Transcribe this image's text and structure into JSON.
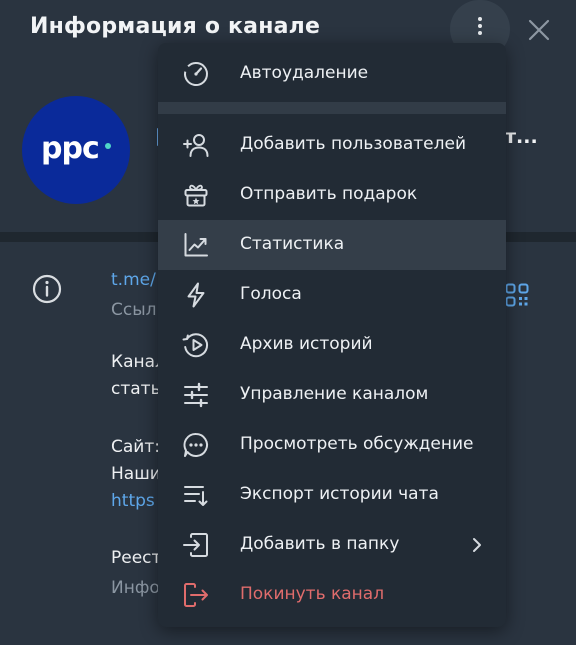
{
  "header": {
    "title": "Информация о канале"
  },
  "channel": {
    "avatar_text": "ppc",
    "name_tail": "т...",
    "colors": {
      "avatar_bg": "#0a2a9a",
      "accent": "#4fd6c8"
    }
  },
  "info": {
    "link_text": "t.me/",
    "link_caption": "Ссыл",
    "desc_line1": "Канал",
    "desc_line2": "стать",
    "site_line1": "Сайт:",
    "site_line2": "Наши",
    "site_link": "https",
    "registry_line1": "Реест",
    "registry_line2": "Инфо"
  },
  "menu": {
    "items": [
      {
        "label": "Автоудаление",
        "icon": "timer-icon"
      },
      {
        "label": "Добавить пользователей",
        "icon": "add-user-icon"
      },
      {
        "label": "Отправить подарок",
        "icon": "gift-icon"
      },
      {
        "label": "Статистика",
        "icon": "statistics-icon"
      },
      {
        "label": "Голоса",
        "icon": "boost-lightning-icon"
      },
      {
        "label": "Архив историй",
        "icon": "stories-archive-icon"
      },
      {
        "label": "Управление каналом",
        "icon": "sliders-icon"
      },
      {
        "label": "Просмотреть обсуждение",
        "icon": "discussion-icon"
      },
      {
        "label": "Экспорт истории чата",
        "icon": "export-icon"
      },
      {
        "label": "Добавить в папку",
        "icon": "folder-add-icon"
      },
      {
        "label": "Покинуть канал",
        "icon": "leave-icon"
      }
    ],
    "danger_color": "#e06c6c"
  }
}
